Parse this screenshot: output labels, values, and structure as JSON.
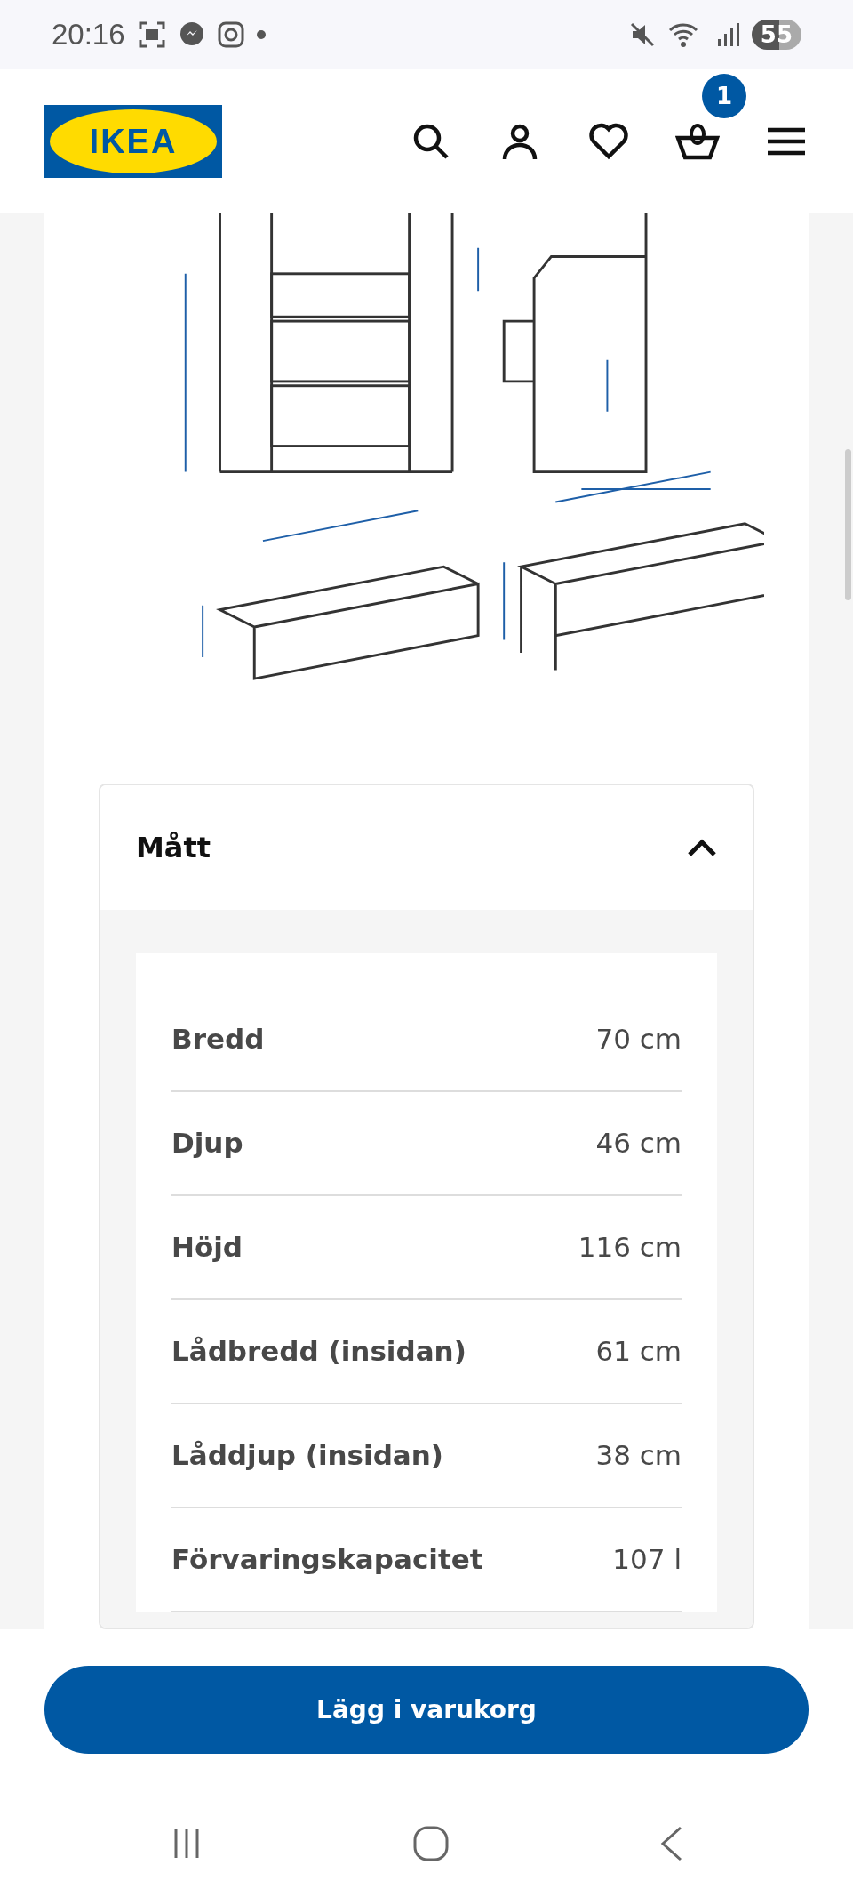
{
  "status_bar": {
    "time": "20:16",
    "battery": "55"
  },
  "header": {
    "logo": "IKEA",
    "cart_count": "1"
  },
  "accordion": {
    "title": "Mått",
    "expanded": true,
    "rows": [
      {
        "label": "Bredd",
        "value": "70 cm"
      },
      {
        "label": "Djup",
        "value": "46 cm"
      },
      {
        "label": "Höjd",
        "value": "116 cm"
      },
      {
        "label": "Lådbredd (insidan)",
        "value": "61 cm"
      },
      {
        "label": "Låddjup (insidan)",
        "value": "38 cm"
      },
      {
        "label": "Förvaringskapacitet",
        "value": "107 l"
      }
    ]
  },
  "add_to_cart": {
    "label": "Lägg i varukorg"
  }
}
